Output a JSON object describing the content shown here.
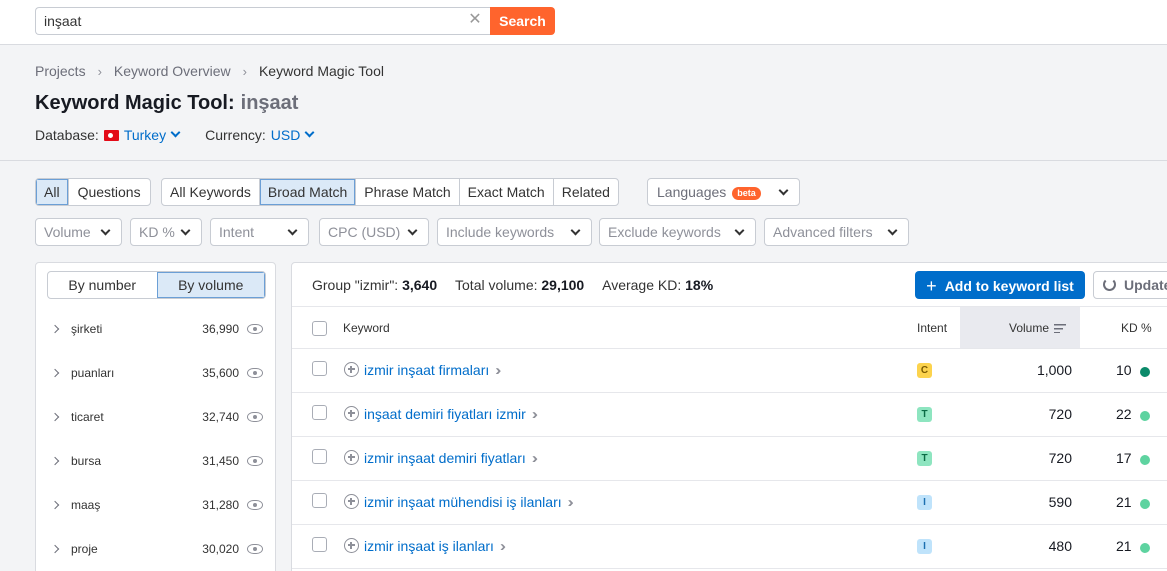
{
  "search": {
    "value": "inşaat",
    "clear": "✕",
    "button": "Search"
  },
  "breadcrumb": [
    "Projects",
    "Keyword Overview",
    "Keyword Magic Tool"
  ],
  "title": {
    "label": "Keyword Magic Tool:",
    "query": "inşaat"
  },
  "database": {
    "label": "Database:",
    "value": "Turkey"
  },
  "currency": {
    "label": "Currency:",
    "value": "USD"
  },
  "tabs_type": [
    "All",
    "Questions"
  ],
  "tabs_match": [
    "All Keywords",
    "Broad Match",
    "Phrase Match",
    "Exact Match",
    "Related"
  ],
  "languages": {
    "label": "Languages",
    "badge": "beta"
  },
  "filters": [
    "Volume",
    "KD %",
    "Intent",
    "CPC (USD)",
    "Include keywords",
    "Exclude keywords",
    "Advanced filters"
  ],
  "group_toggle": [
    "By number",
    "By volume"
  ],
  "groups": [
    {
      "name": "şirketi",
      "count": "36,990"
    },
    {
      "name": "puanları",
      "count": "35,600"
    },
    {
      "name": "ticaret",
      "count": "32,740"
    },
    {
      "name": "bursa",
      "count": "31,450"
    },
    {
      "name": "maaş",
      "count": "31,280"
    },
    {
      "name": "proje",
      "count": "30,020"
    }
  ],
  "summary": {
    "group_label": "Group \"izmir\":",
    "group_value": "3,640",
    "volume_label": "Total volume:",
    "volume_value": "29,100",
    "kd_label": "Average KD:",
    "kd_value": "18%"
  },
  "actions": {
    "add": "Add to keyword list",
    "update": "Update"
  },
  "table_headers": {
    "keyword": "Keyword",
    "intent": "Intent",
    "volume": "Volume",
    "kd": "KD %"
  },
  "rows": [
    {
      "keyword": "izmir inşaat firmaları",
      "intent": "C",
      "volume": "1,000",
      "kd": "10"
    },
    {
      "keyword": "inşaat demiri fiyatları izmir",
      "intent": "T",
      "volume": "720",
      "kd": "22"
    },
    {
      "keyword": "izmir inşaat demiri fiyatları",
      "intent": "T",
      "volume": "720",
      "kd": "17"
    },
    {
      "keyword": "izmir inşaat mühendisi iş ilanları",
      "intent": "I",
      "volume": "590",
      "kd": "21"
    },
    {
      "keyword": "izmir inşaat iş ilanları",
      "intent": "I",
      "volume": "480",
      "kd": "21"
    }
  ],
  "colors": {
    "accent": "#006dca",
    "search_button": "#ff642d",
    "intent_C_bg": "#fcd34d",
    "intent_C_fg": "#7a5a00",
    "intent_T_bg": "#8ee5c0",
    "intent_T_fg": "#0b6b45",
    "intent_I_bg": "#bfe3fb",
    "intent_I_fg": "#1c6fb0",
    "kd_dark": "#0b8a6a",
    "kd_light": "#5ed3a0"
  }
}
